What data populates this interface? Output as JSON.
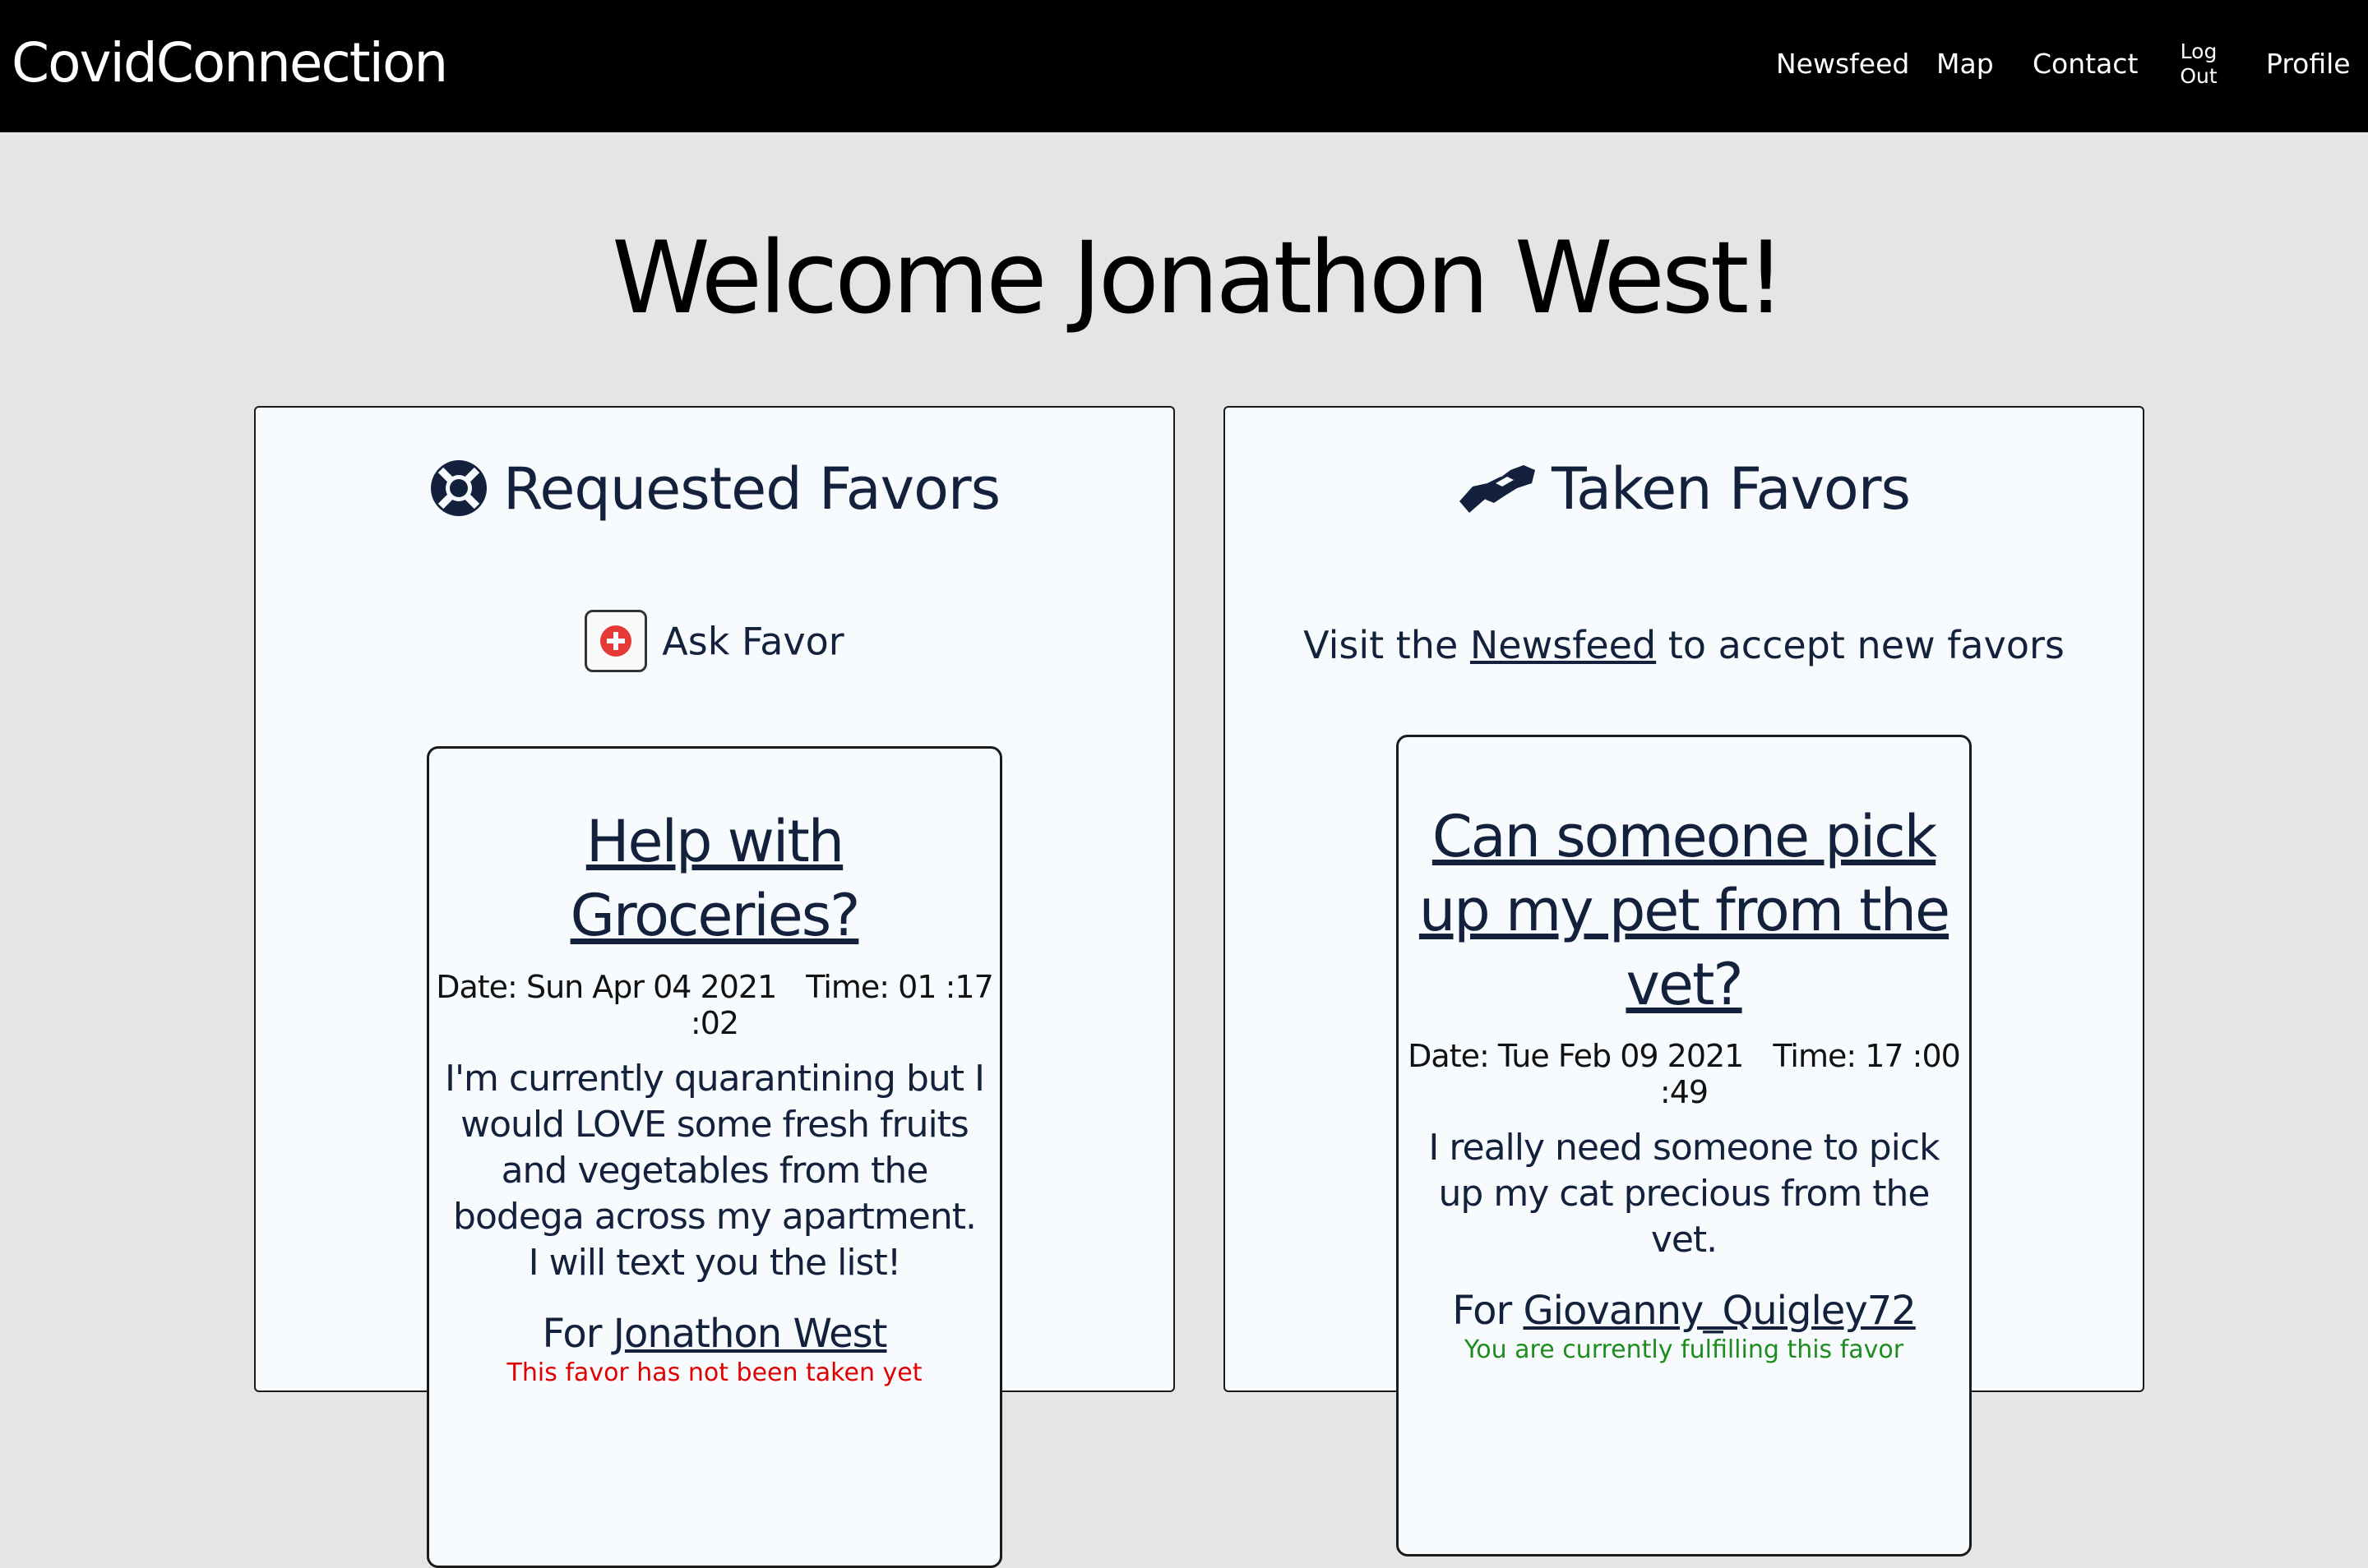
{
  "navbar": {
    "brand": "CovidConnection",
    "links": {
      "newsfeed": "Newsfeed",
      "map": "Map",
      "contact": "Contact",
      "logout": "Log Out",
      "profile": "Profile"
    }
  },
  "welcome": "Welcome Jonathon West!",
  "requested": {
    "title": "Requested Favors",
    "ask_label": "Ask Favor",
    "card": {
      "title": "Help with Groceries?",
      "date": "Date: Sun Apr 04 2021",
      "time": "Time: 01 :17 :02",
      "description": "I'm currently quarantining but I would LOVE some fresh fruits and vegetables from the bodega across my apartment. I will text you the list!",
      "for_label": "For",
      "for_name": "Jonathon West",
      "status": "This favor has not been taken yet",
      "status_color": "#e00000"
    }
  },
  "taken": {
    "title": "Taken Favors",
    "visit_prefix": "Visit the",
    "visit_link": "Newsfeed",
    "visit_suffix": "to accept new favors",
    "card": {
      "title": "Can someone pick up my pet from the vet?",
      "date": "Date: Tue Feb 09 2021",
      "time": "Time: 17 :00 :49",
      "description": "I really need someone to pick up my cat precious from the vet.",
      "for_label": "For",
      "for_name": "Giovanny_Quigley72",
      "status": "You are currently fulfilling this favor",
      "status_color": "#1e8c1e"
    }
  },
  "colors": {
    "navbar": "#000000",
    "background": "#e5e5e5",
    "panel": "#f7fbfe",
    "text": "#14213d"
  }
}
